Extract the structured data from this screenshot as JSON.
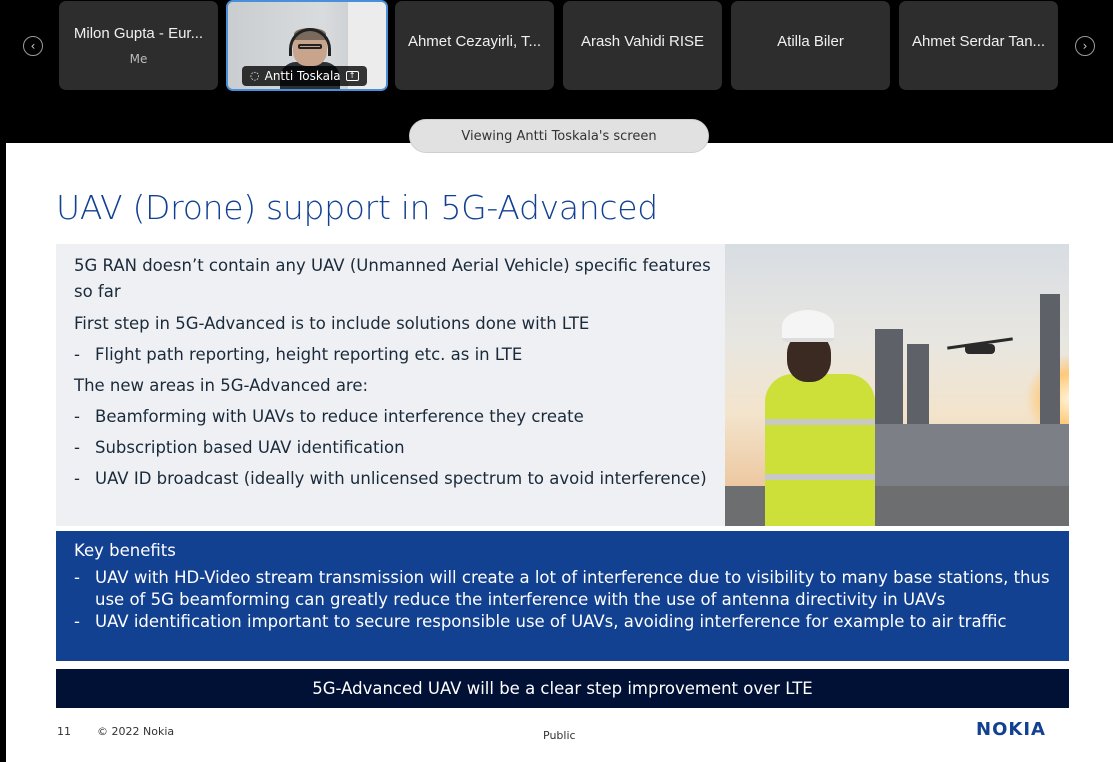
{
  "participants": {
    "prev_icon": "chevron-left-icon",
    "next_icon": "chevron-right-icon",
    "tiles": [
      {
        "name": "Milon Gupta - Eur...",
        "sub": "Me"
      },
      {
        "name": "Antti Toskala",
        "video": true
      },
      {
        "name": "Ahmet Cezayirli, T..."
      },
      {
        "name": "Arash Vahidi RISE"
      },
      {
        "name": "Atilla Biler"
      },
      {
        "name": "Ahmet Serdar Tan..."
      }
    ]
  },
  "share_banner": "Viewing Antti Toskala's screen",
  "slide": {
    "title": "UAV (Drone) support in 5G-Advanced",
    "intro_line1": "5G RAN doesn’t contain any UAV (Unmanned Aerial Vehicle) specific features",
    "intro_line2": "so far",
    "step": "First step in 5G-Advanced is to include solutions done with LTE",
    "step_items": [
      "Flight path reporting, height reporting etc. as in LTE"
    ],
    "new_areas": "The new areas in 5G-Advanced are:",
    "area_items": [
      "Beamforming with UAVs to reduce interference they create",
      "Subscription based UAV identification",
      "UAV ID broadcast (ideally with unlicensed spectrum to avoid interference)"
    ],
    "benefits_title": "Key benefits",
    "benefits": [
      "UAV with HD-Video stream transmission will create a lot of interference due to visibility to many base stations, thus use of 5G beamforming can greatly reduce the interference with the use of antenna directivity in UAVs",
      "UAV identification important to secure responsible use of UAVs, avoiding interference for example to air traffic"
    ],
    "conclusion": "5G-Advanced UAV will be a clear step improvement over  LTE",
    "page_number": "11",
    "copyright": "© 2022 Nokia",
    "classification": "Public",
    "logo_text": "NOKIA"
  }
}
